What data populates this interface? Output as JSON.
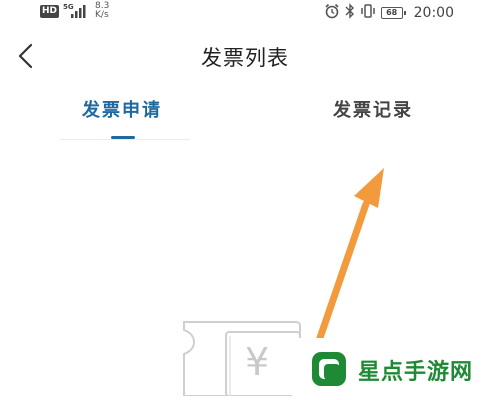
{
  "status_bar": {
    "hd_badge": "HD",
    "network_type": "5G",
    "speed_value": "8.3",
    "speed_unit": "K/s",
    "battery_level": "68",
    "time": "20:00",
    "icons": [
      "alarm-icon",
      "bluetooth-icon",
      "vibrate-icon",
      "battery-icon"
    ]
  },
  "header": {
    "back_icon": "chevron-left-icon",
    "title": "发票列表"
  },
  "tabs": [
    {
      "label": "发票申请",
      "active": true
    },
    {
      "label": "发票记录",
      "active": false
    }
  ],
  "colors": {
    "accent": "#1e6aa0",
    "arrow": "#f39a3c",
    "watermark_green": "#1f8a35"
  },
  "empty_state": {
    "icon": "invoice-icon",
    "symbol": "¥"
  },
  "watermark": {
    "text": "星点手游网"
  }
}
